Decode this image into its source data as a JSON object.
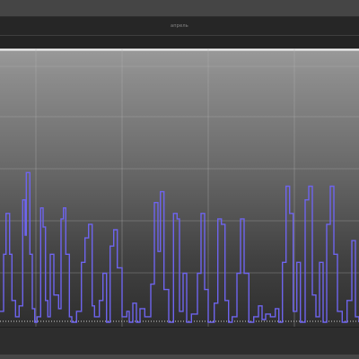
{
  "window": {
    "title": "апрель"
  },
  "colors": {
    "series": "#6e64ee",
    "grid": "#b5b5b5",
    "baseline": "#d0d0d0",
    "background_top": "#9a9a9a",
    "background_bottom": "#2e2e2e"
  },
  "chart_data": {
    "type": "line",
    "title": "апрель",
    "xlabel": "",
    "ylabel": "",
    "ylim": [
      0,
      100
    ],
    "xlim": [
      0,
      30
    ],
    "grid": true,
    "legend": "none",
    "series": [
      {
        "values": [
          [
            0,
            4
          ],
          [
            0.3,
            25
          ],
          [
            0.5,
            40
          ],
          [
            0.8,
            25
          ],
          [
            1.0,
            8
          ],
          [
            1.3,
            2
          ],
          [
            1.6,
            6
          ],
          [
            1.9,
            45
          ],
          [
            2.1,
            32
          ],
          [
            2.2,
            55
          ],
          [
            2.5,
            25
          ],
          [
            2.7,
            5
          ],
          [
            2.9,
            0
          ],
          [
            3.1,
            2
          ],
          [
            3.4,
            42
          ],
          [
            3.6,
            35
          ],
          [
            3.8,
            8
          ],
          [
            4.0,
            2
          ],
          [
            4.2,
            25
          ],
          [
            4.5,
            10
          ],
          [
            4.9,
            5
          ],
          [
            5.1,
            38
          ],
          [
            5.3,
            42
          ],
          [
            5.5,
            25
          ],
          [
            5.8,
            2
          ],
          [
            6.0,
            0
          ],
          [
            6.4,
            4
          ],
          [
            6.8,
            22
          ],
          [
            7.1,
            31
          ],
          [
            7.4,
            36
          ],
          [
            7.7,
            6
          ],
          [
            7.9,
            2
          ],
          [
            8.3,
            8
          ],
          [
            8.6,
            18
          ],
          [
            8.9,
            0
          ],
          [
            9.2,
            28
          ],
          [
            9.5,
            34
          ],
          [
            9.8,
            20
          ],
          [
            10.2,
            2
          ],
          [
            10.6,
            4
          ],
          [
            10.8,
            0
          ],
          [
            11.1,
            7
          ],
          [
            11.4,
            0
          ],
          [
            11.7,
            5
          ],
          [
            12.1,
            2
          ],
          [
            12.6,
            14
          ],
          [
            12.9,
            44
          ],
          [
            13.2,
            26
          ],
          [
            13.4,
            48
          ],
          [
            13.7,
            12
          ],
          [
            14.1,
            0
          ],
          [
            14.5,
            40
          ],
          [
            14.8,
            38
          ],
          [
            15.0,
            4
          ],
          [
            15.3,
            18
          ],
          [
            15.6,
            0
          ],
          [
            16.0,
            3
          ],
          [
            16.5,
            18
          ],
          [
            16.8,
            40
          ],
          [
            17.1,
            12
          ],
          [
            17.4,
            0
          ],
          [
            17.9,
            7
          ],
          [
            18.2,
            38
          ],
          [
            18.5,
            36
          ],
          [
            18.8,
            8
          ],
          [
            19.1,
            0
          ],
          [
            19.4,
            2
          ],
          [
            19.8,
            18
          ],
          [
            20.1,
            38
          ],
          [
            20.4,
            18
          ],
          [
            20.8,
            0
          ],
          [
            21.2,
            2
          ],
          [
            21.6,
            6
          ],
          [
            21.9,
            1
          ],
          [
            22.2,
            3
          ],
          [
            22.6,
            2
          ],
          [
            23.0,
            5
          ],
          [
            23.3,
            0
          ],
          [
            23.6,
            22
          ],
          [
            23.9,
            50
          ],
          [
            24.2,
            40
          ],
          [
            24.5,
            4
          ],
          [
            24.8,
            22
          ],
          [
            25.1,
            0
          ],
          [
            25.5,
            45
          ],
          [
            25.8,
            50
          ],
          [
            26.1,
            10
          ],
          [
            26.4,
            2
          ],
          [
            26.7,
            22
          ],
          [
            27.0,
            0
          ],
          [
            27.3,
            36
          ],
          [
            27.6,
            50
          ],
          [
            27.9,
            25
          ],
          [
            28.2,
            4
          ],
          [
            28.6,
            0
          ],
          [
            29.0,
            8
          ],
          [
            29.4,
            30
          ],
          [
            29.7,
            2
          ],
          [
            30,
            0
          ]
        ]
      }
    ]
  }
}
